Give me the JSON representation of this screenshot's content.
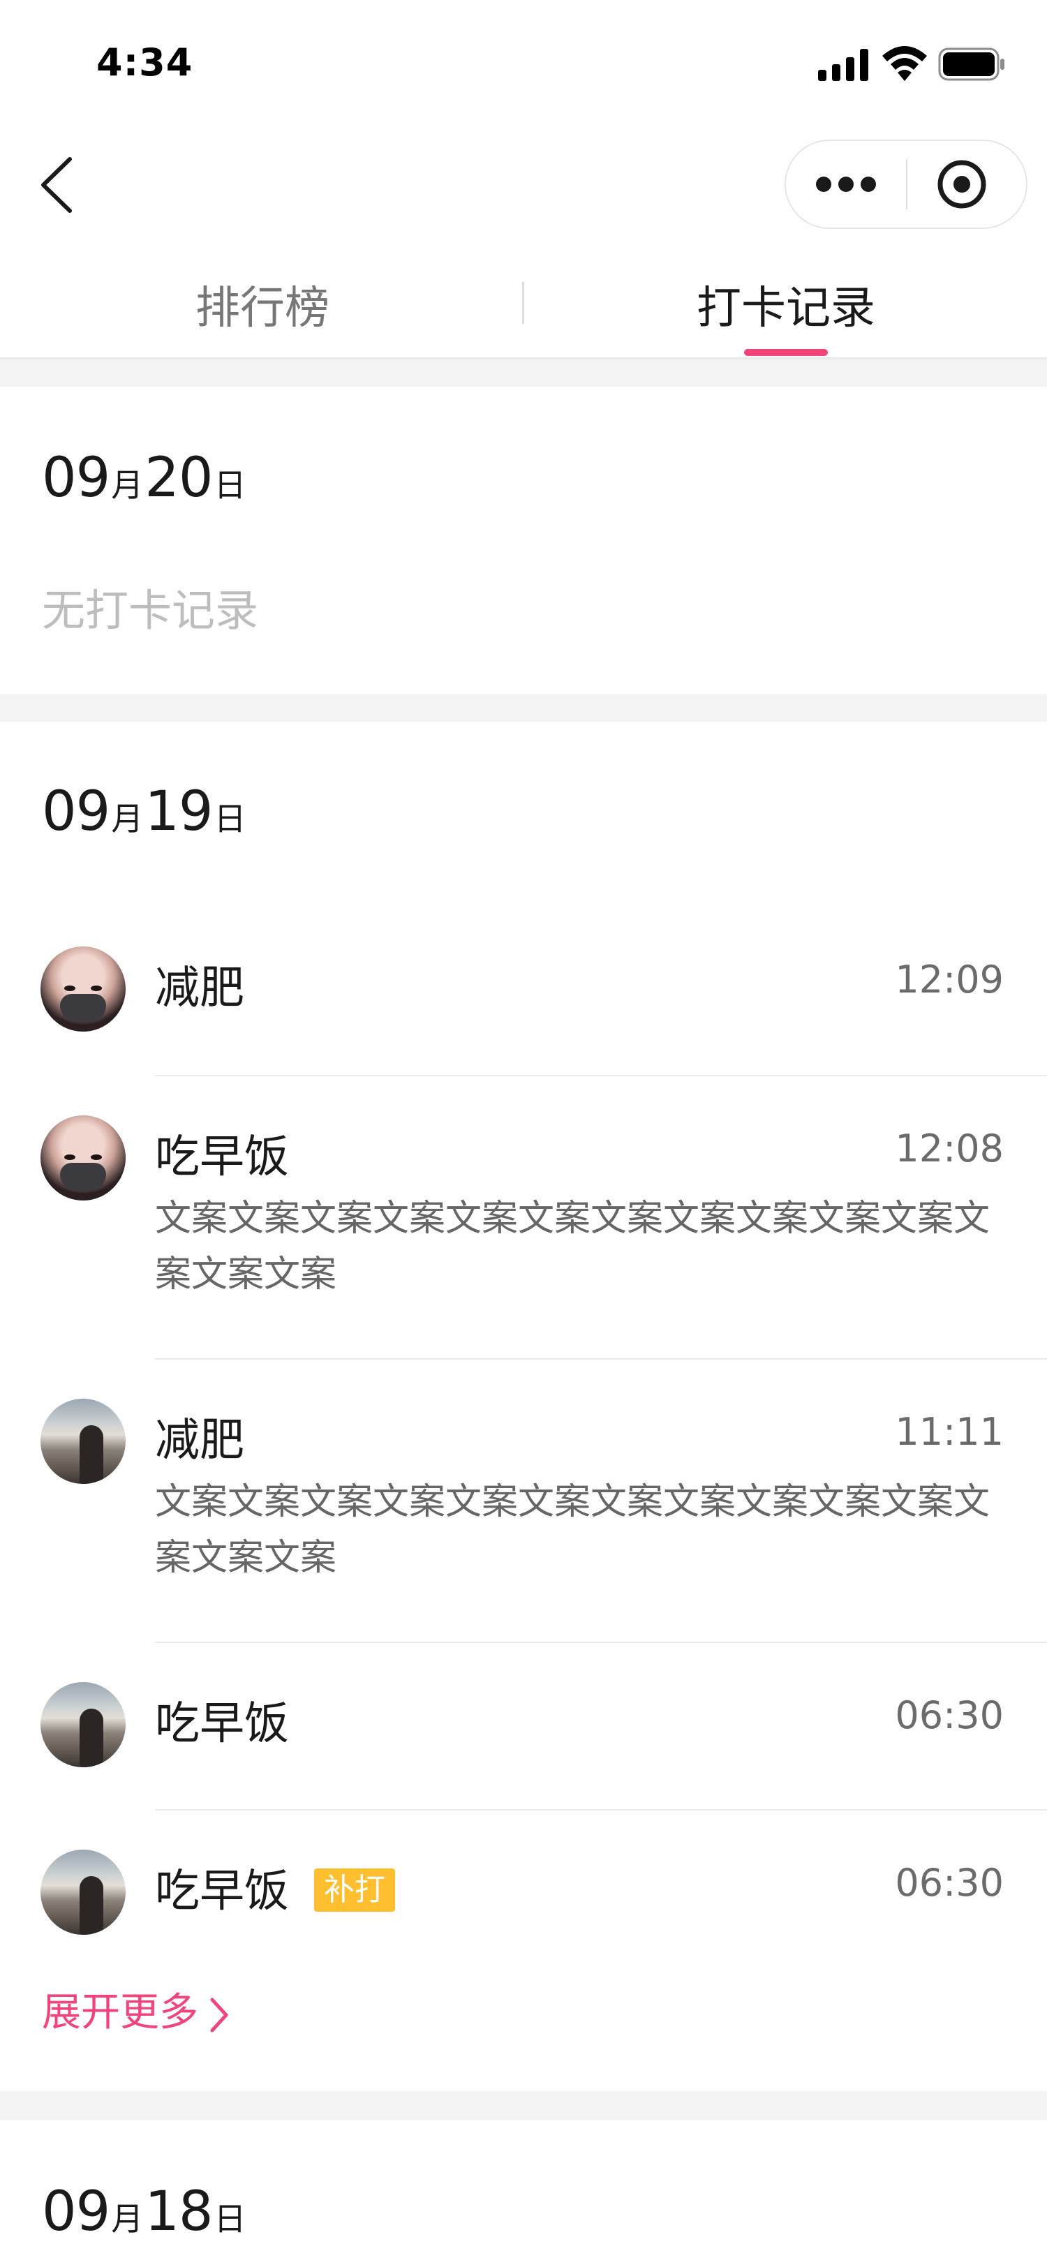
{
  "status_bar": {
    "time": "4:34"
  },
  "tabs": [
    {
      "label": "排行榜",
      "active": false
    },
    {
      "label": "打卡记录",
      "active": true
    }
  ],
  "accent_color": "#f0457a",
  "days": [
    {
      "month": "09",
      "month_unit": "月",
      "day": "20",
      "day_unit": "日",
      "empty_text": "无打卡记录"
    },
    {
      "month": "09",
      "month_unit": "月",
      "day": "19",
      "day_unit": "日",
      "records": [
        {
          "title": "减肥",
          "time": "12:09",
          "avatar": "avatar-masked-girl"
        },
        {
          "title": "吃早饭",
          "time": "12:08",
          "avatar": "avatar-masked-girl",
          "desc": "文案文案文案文案文案文案文案文案文案文案文案文案文案文案"
        },
        {
          "title": "减肥",
          "time": "11:11",
          "avatar": "avatar-sunset-photo",
          "desc": "文案文案文案文案文案文案文案文案文案文案文案文案文案文案"
        },
        {
          "title": "吃早饭",
          "time": "06:30",
          "avatar": "avatar-sunset-photo"
        },
        {
          "title": "吃早饭",
          "time": "06:30",
          "avatar": "avatar-sunset-photo",
          "badge": "补打"
        }
      ],
      "expand_label": "展开更多"
    },
    {
      "month": "09",
      "month_unit": "月",
      "day": "18",
      "day_unit": "日"
    }
  ]
}
